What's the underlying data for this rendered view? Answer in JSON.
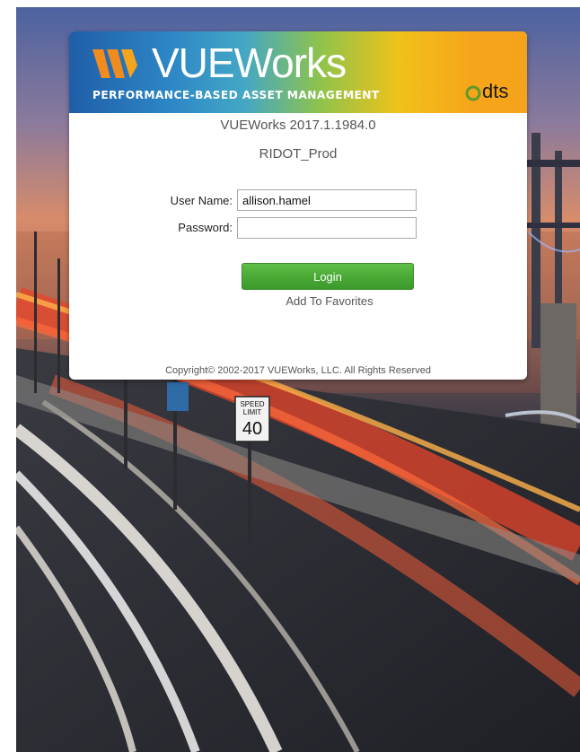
{
  "brand": {
    "product_name": "VUEWorks",
    "tagline": "PERFORMANCE-BASED ASSET MANAGEMENT",
    "partner_name": "dts"
  },
  "app": {
    "version": "VUEWorks 2017.1.1984.0",
    "environment": "RIDOT_Prod"
  },
  "login_form": {
    "username_label": "User Name:",
    "username_value": "allison.hamel",
    "password_label": "Password:",
    "password_value": "",
    "login_button_label": "Login",
    "favorites_link_label": "Add To Favorites"
  },
  "footer": {
    "copyright": "Copyright© 2002-2017 VUEWorks, LLC. All Rights Reserved"
  },
  "background": {
    "speed_sign_top": "SPEED",
    "speed_sign_middle": "LIMIT",
    "speed_sign_value": "40"
  },
  "colors": {
    "login_button": "#48a834",
    "brand_blue": "#1f5ea8",
    "brand_orange": "#f5a31a"
  }
}
